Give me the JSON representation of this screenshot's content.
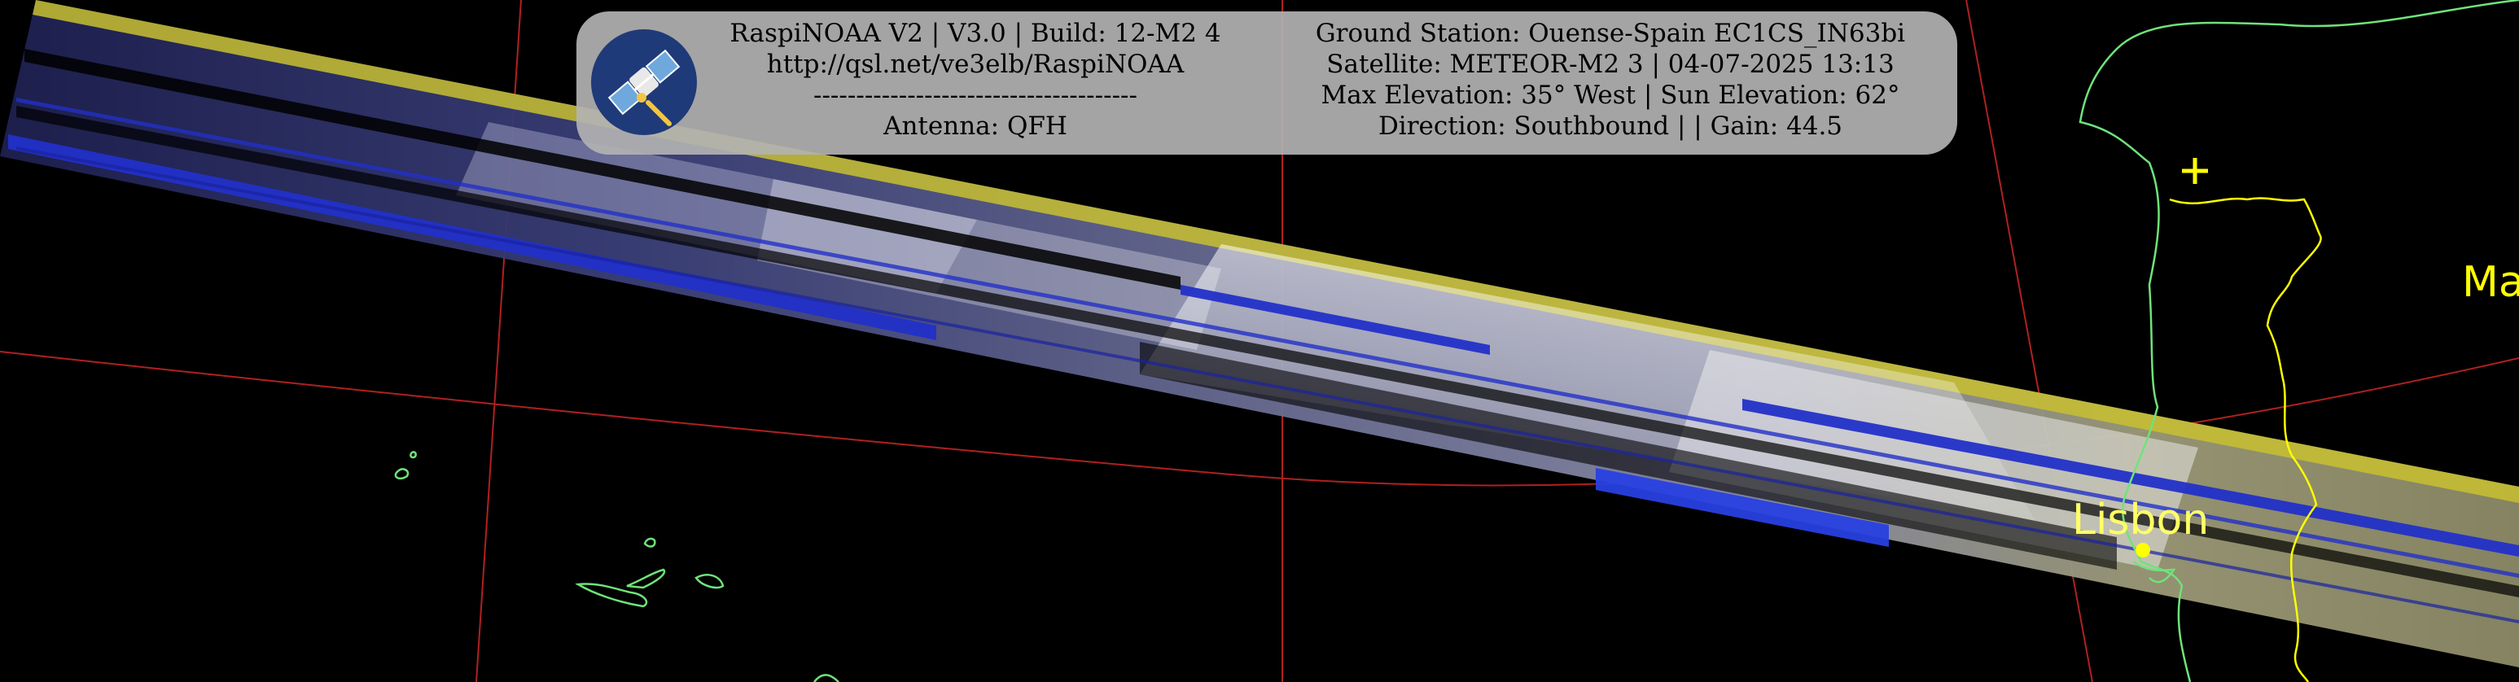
{
  "header": {
    "left_lines": [
      "RaspiNOAA V2 | V3.0 | Build: 12-M2 4",
      "http://qsl.net/ve3elb/RaspiNOAA",
      "--------------------------------------",
      "Antenna: QFH"
    ],
    "right_lines": [
      "Ground Station: Ouense-Spain EC1CS_IN63bi",
      "Satellite: METEOR-M2 3 | 04-07-2025 13:13",
      "Max Elevation: 35° West | Sun Elevation: 62°",
      "Direction: Southbound | | Gain: 44.5"
    ]
  },
  "labels": {
    "lisbon": "Lisbon",
    "partial_right": "Ma"
  },
  "colors": {
    "background": "#000000",
    "grid": "#b02020",
    "coastline": "#6fe37a",
    "border": "#ffff00",
    "panel": "#b2b2b2",
    "swath_blue": "#2230c8",
    "swath_yellow": "#d8d040"
  },
  "icons": {
    "logo": "satellite-icon",
    "ground_station": "plus-marker-icon",
    "city": "city-dot-icon"
  }
}
